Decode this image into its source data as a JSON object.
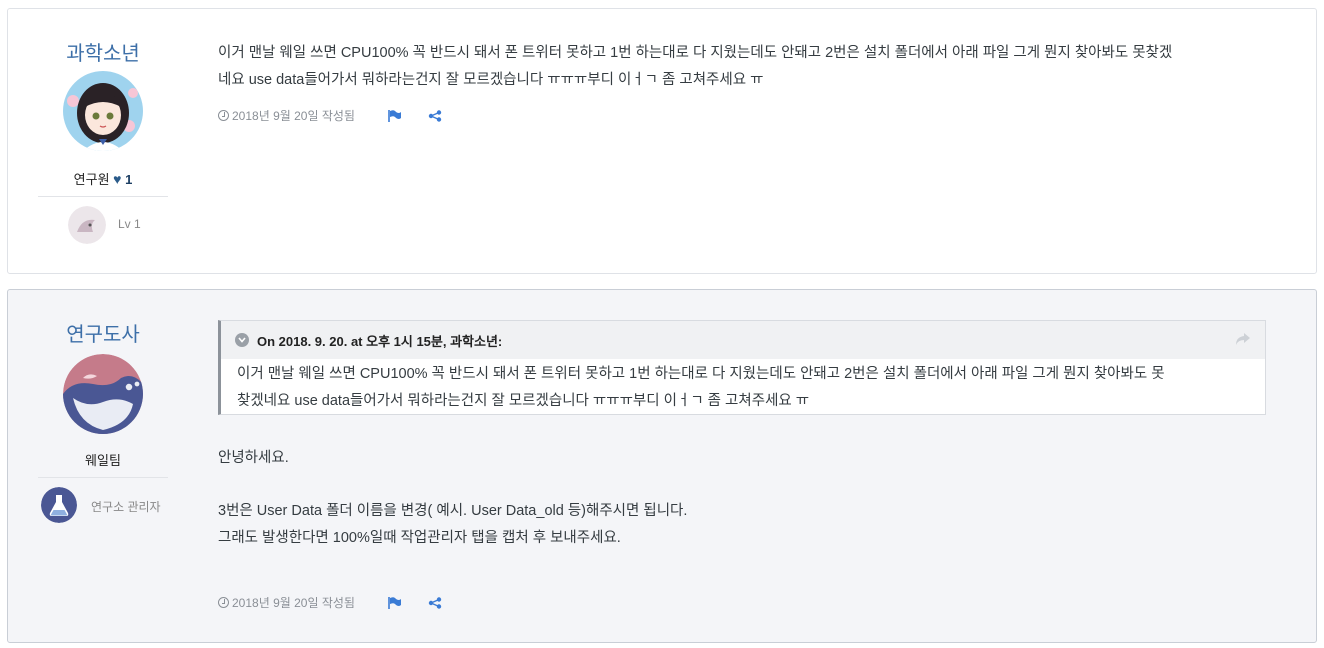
{
  "posts": [
    {
      "author": {
        "name": "과학소년",
        "rank": "연구원",
        "reputation": "1",
        "level": "Lv 1"
      },
      "content": [
        "이거 맨날 웨일 쓰면 CPU100% 꼭 반드시 돼서 폰 트위터 못하고 1번 하는대로 다 지웠는데도 안돼고 2번은 설치 폴더에서 아래 파일 그게 뭔지 찾아봐도 못찾겠",
        "네요 use data들어가서 뭐하라는건지 잘 모르겠습니다 ㅠㅠㅠ부디 이ㅓㄱ 좀 고쳐주세요 ㅠ"
      ],
      "date": "2018년 9월 20일 작성됨"
    },
    {
      "author": {
        "name": "연구도사",
        "rank": "웨일팀",
        "level": "연구소 관리자"
      },
      "quote": {
        "header": "On 2018. 9. 20. at 오후 1시 15분, 과학소년:",
        "lines": [
          "이거 맨날 웨일 쓰면 CPU100% 꼭 반드시 돼서 폰 트위터 못하고 1번 하는대로 다 지웠는데도 안돼고 2번은 설치 폴더에서 아래 파일 그게 뭔지 찾아봐도 못",
          "찾겠네요 use data들어가서 뭐하라는건지 잘 모르겠습니다 ㅠㅠㅠ부디 이ㅓㄱ 좀 고쳐주세요 ㅠ"
        ]
      },
      "reply": {
        "greeting": "안녕하세요.",
        "line1": "3번은 User Data 폴더 이름을 변경( 예시. User Data_old 등)해주시면 됩니다.",
        "line2": "그래도 발생한다면 100%일때 작업관리자 탭을 캡처 후 보내주세요."
      },
      "date": "2018년 9월 20일 작성됨"
    }
  ],
  "icons": {
    "clock": "clock-icon",
    "flag": "flag-icon",
    "share": "share-icon",
    "heart": "heart-icon",
    "quote_toggle": "chevron-down-icon",
    "quote_share": "reply-arrow-icon"
  },
  "colors": {
    "author_name": "#3d6fa8",
    "icon_blue": "#3a7bd5",
    "alt_background": "#f4f5f8"
  }
}
